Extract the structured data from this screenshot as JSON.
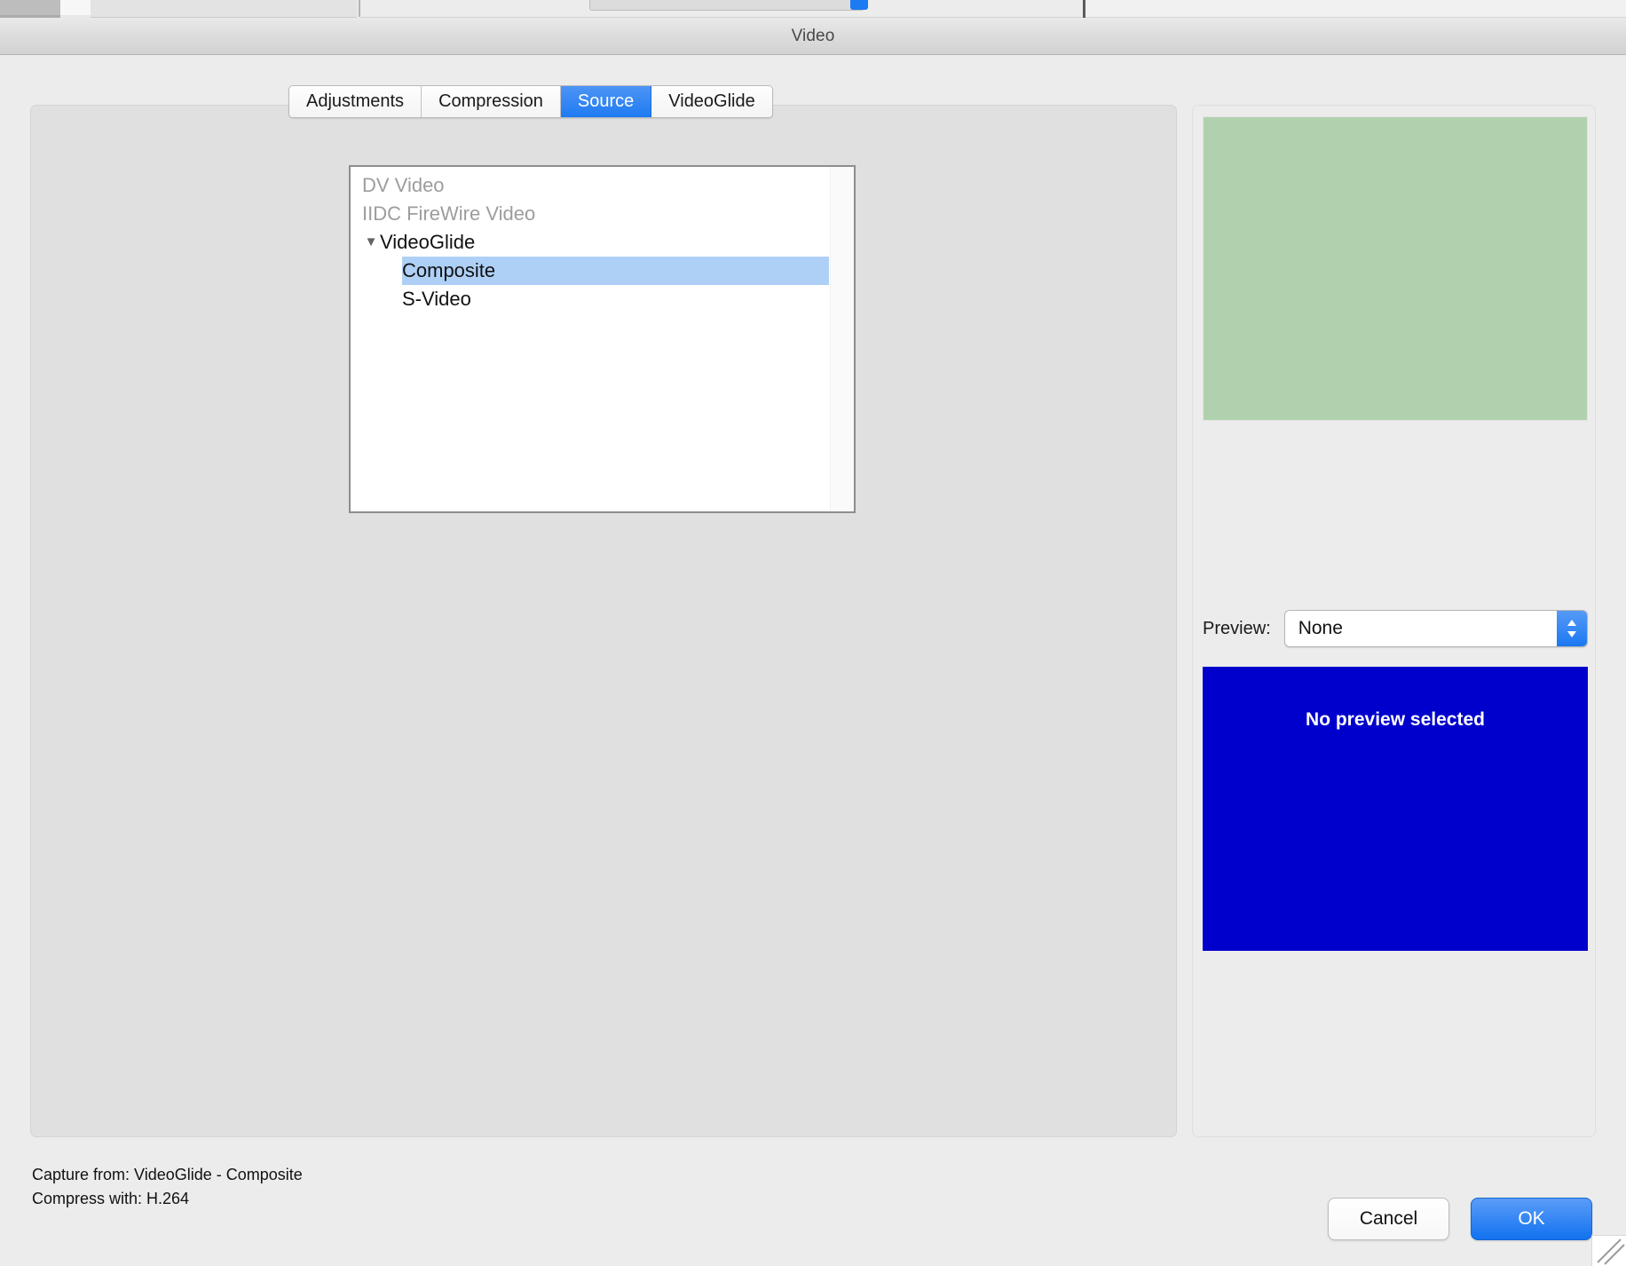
{
  "window": {
    "title": "Video"
  },
  "tabs": [
    {
      "label": "Adjustments",
      "selected": false
    },
    {
      "label": "Compression",
      "selected": false
    },
    {
      "label": "Source",
      "selected": true
    },
    {
      "label": "VideoGlide",
      "selected": false
    }
  ],
  "source_list": {
    "items": [
      {
        "label": "DV Video",
        "level": 0,
        "disabled": true,
        "group": false,
        "selected": false
      },
      {
        "label": "IIDC FireWire Video",
        "level": 0,
        "disabled": true,
        "group": false,
        "selected": false
      },
      {
        "label": "VideoGlide",
        "level": 0,
        "disabled": false,
        "group": true,
        "expanded": true,
        "selected": false
      },
      {
        "label": "Composite",
        "level": 1,
        "disabled": false,
        "group": false,
        "selected": true
      },
      {
        "label": "S-Video",
        "level": 1,
        "disabled": false,
        "group": false,
        "selected": false
      }
    ],
    "disclosure_glyph": "▼"
  },
  "right_panel": {
    "preview_image_color": "#b0d1ae",
    "preview_label": "Preview:",
    "preview_value": "None",
    "preview_box_text": "No preview selected",
    "preview_box_color": "#0000cc"
  },
  "status": {
    "capture_from": "Capture from: VideoGlide - Composite",
    "compress_with": "Compress with: H.264"
  },
  "buttons": {
    "cancel": "Cancel",
    "ok": "OK"
  },
  "colors": {
    "accent_blue": "#1f7bf2",
    "selection_blue": "#aed0f7",
    "preview_blue": "#0000cc",
    "preview_green": "#b0d1ae"
  }
}
